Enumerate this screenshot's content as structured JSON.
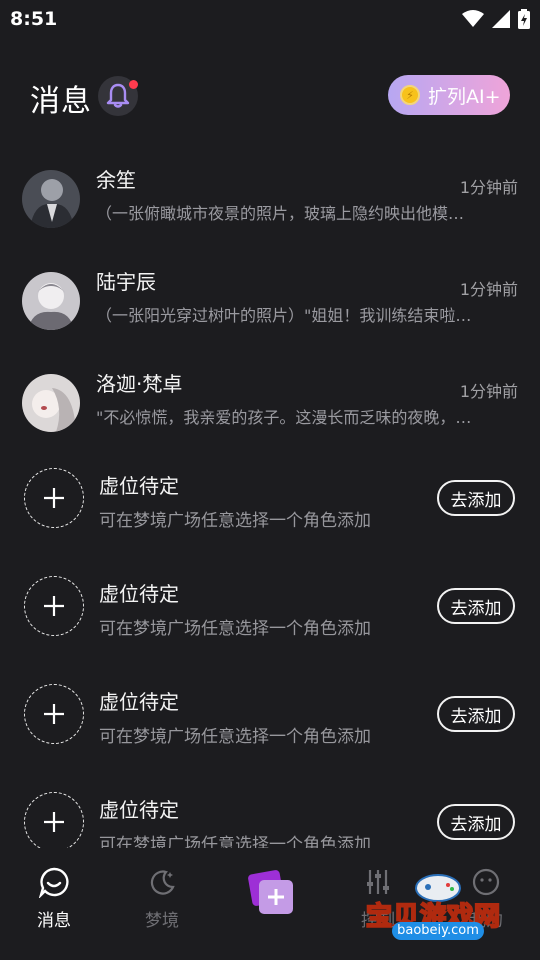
{
  "status_bar": {
    "time": "8:51"
  },
  "header": {
    "title": "消息",
    "ai_button_label": "扩列AI+"
  },
  "chats": [
    {
      "name": "余笙",
      "time": "1分钟前",
      "preview": "（一张俯瞰城市夜景的照片，玻璃上隐约映出他模…"
    },
    {
      "name": "陆宇辰",
      "time": "1分钟前",
      "preview": "（一张阳光穿过树叶的照片）\"姐姐！我训练结束啦…"
    },
    {
      "name": "洛迦·梵卓",
      "time": "1分钟前",
      "preview": "\"不必惊慌，我亲爱的孩子。这漫长而乏味的夜晚，…"
    }
  ],
  "slots": [
    {
      "title": "虚位待定",
      "desc": "可在梦境广场任意选择一个角色添加",
      "button": "去添加"
    },
    {
      "title": "虚位待定",
      "desc": "可在梦境广场任意选择一个角色添加",
      "button": "去添加"
    },
    {
      "title": "虚位待定",
      "desc": "可在梦境广场任意选择一个角色添加",
      "button": "去添加"
    },
    {
      "title": "虚位待定",
      "desc": "可在梦境广场任意选择一个角色添加",
      "button": "去添加"
    }
  ],
  "tabbar": {
    "messages": "消息",
    "dream": "梦境",
    "control": "控制",
    "mine": "我的"
  },
  "watermark": {
    "text": "宝贝游戏网",
    "url": "baobeiy.com"
  },
  "colors": {
    "accent_gradient_start": "#b7a7f2",
    "accent_gradient_end": "#efa4d9",
    "notification_dot": "#ff3b4e",
    "background": "#1c1c1f"
  }
}
